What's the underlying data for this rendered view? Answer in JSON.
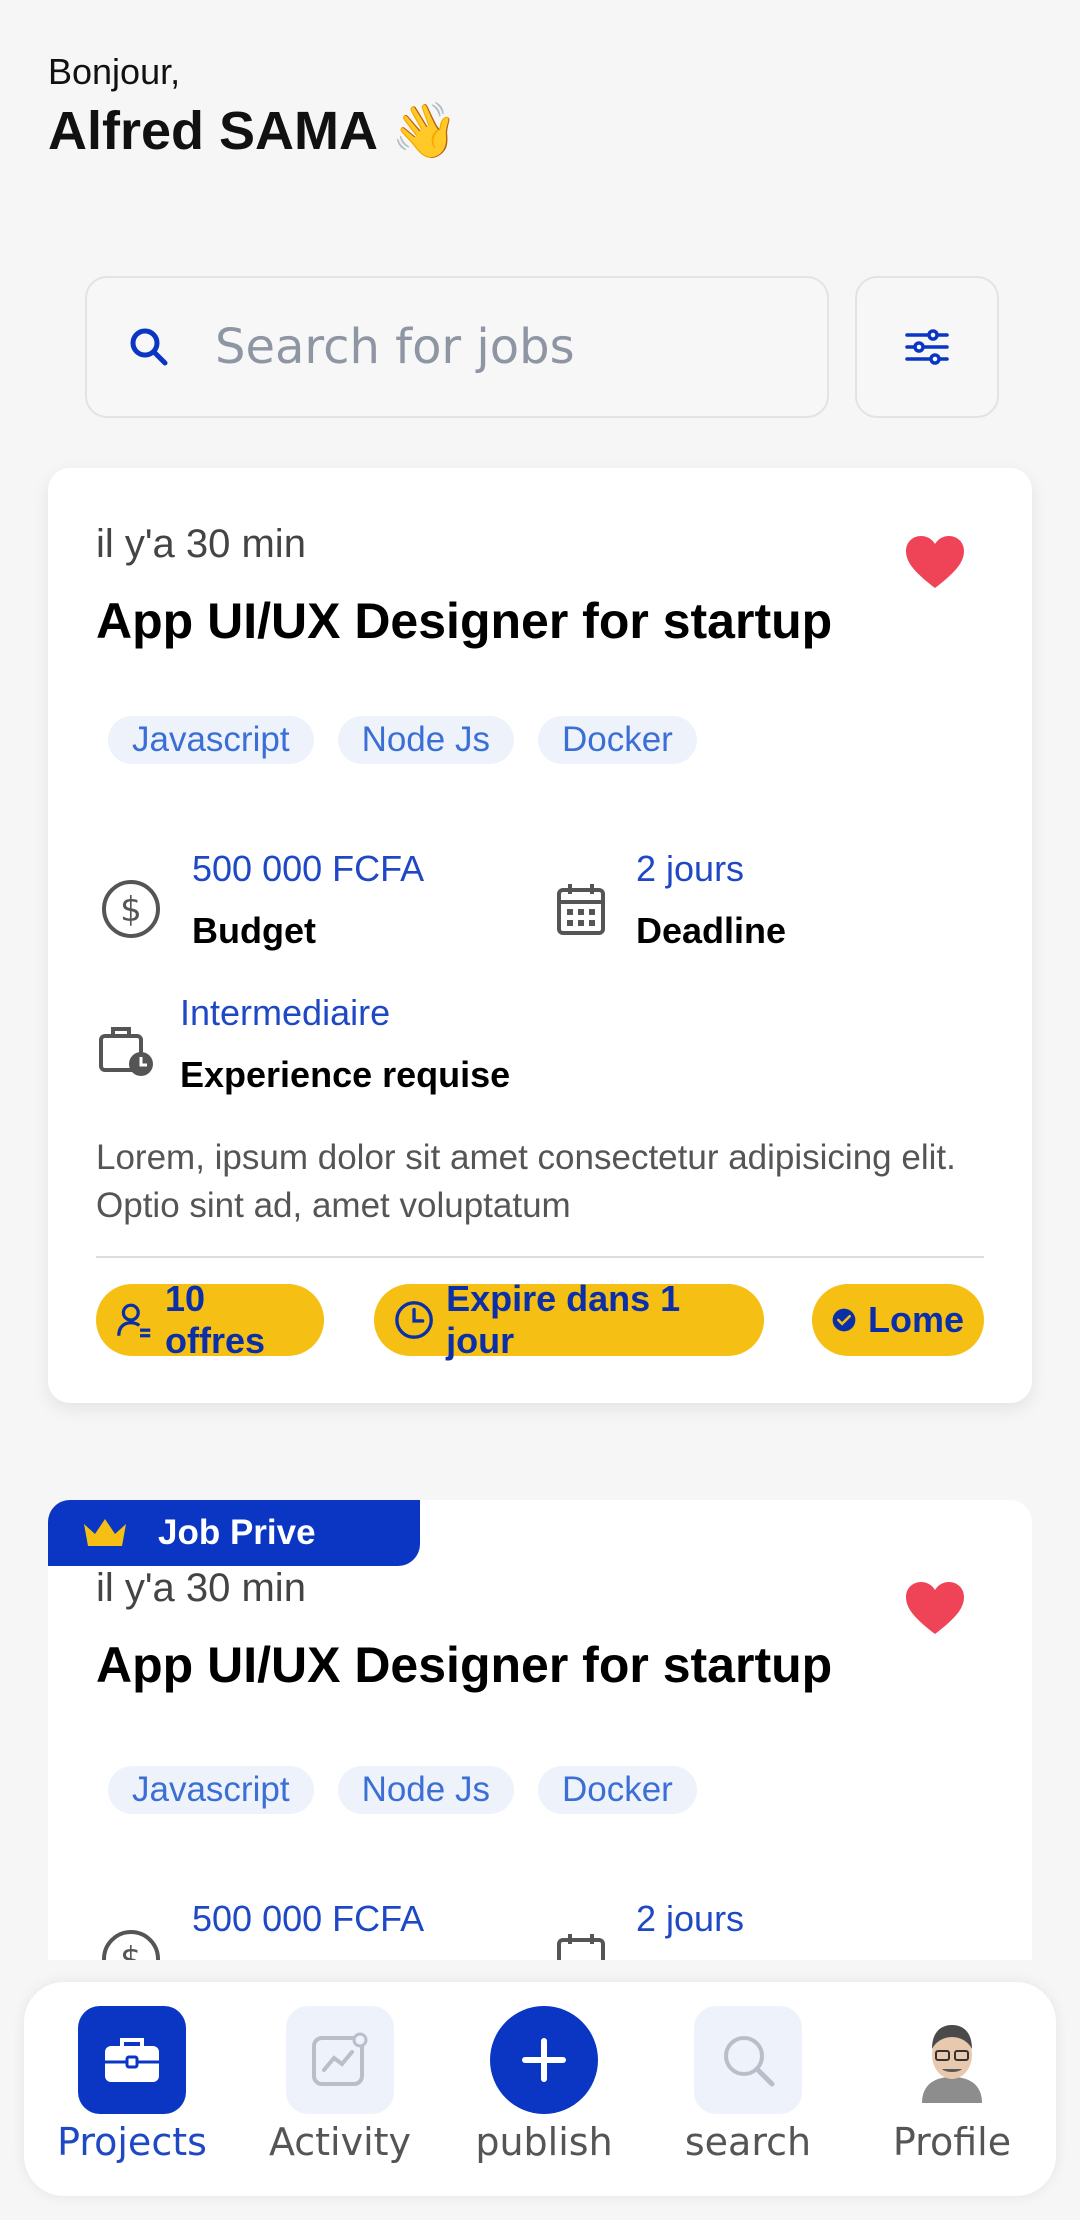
{
  "header": {
    "greeting": "Bonjour,",
    "user_name": "Alfred SAMA 👋"
  },
  "search": {
    "placeholder": "Search for jobs"
  },
  "jobs": [
    {
      "time": "il y'a 30 min",
      "title": "App UI/UX Designer for startup",
      "favorited": true,
      "tags": [
        "Javascript",
        "Node Js",
        "Docker"
      ],
      "budget_value": "500 000 FCFA",
      "budget_label": "Budget",
      "deadline_value": "2 jours",
      "deadline_label": "Deadline",
      "experience_value": "Intermediaire",
      "experience_label": "Experience requise",
      "description": "Lorem, ipsum dolor sit amet consectetur adipisicing elit. Optio sint ad, amet voluptatum",
      "offers": "10 offres",
      "expires": "Expire dans 1 jour",
      "location": "Lome"
    },
    {
      "badge": "Job Prive",
      "time": "il y'a 30 min",
      "title": "App UI/UX Designer for startup",
      "favorited": true,
      "tags": [
        "Javascript",
        "Node Js",
        "Docker"
      ],
      "budget_value": "500 000 FCFA",
      "deadline_value": "2 jours"
    }
  ],
  "nav": [
    {
      "label": "Projects",
      "icon": "briefcase-icon",
      "active": true
    },
    {
      "label": "Activity",
      "icon": "activity-chart-icon",
      "active": false
    },
    {
      "label": "publish",
      "icon": "plus-icon",
      "active": false
    },
    {
      "label": "search",
      "icon": "search-icon",
      "active": false
    },
    {
      "label": "Profile",
      "icon": "avatar",
      "active": false
    }
  ],
  "colors": {
    "primary": "#0a36c3",
    "accent_yellow": "#f5bf13",
    "heart": "#ef4457",
    "tag_bg": "#edf2fb"
  }
}
